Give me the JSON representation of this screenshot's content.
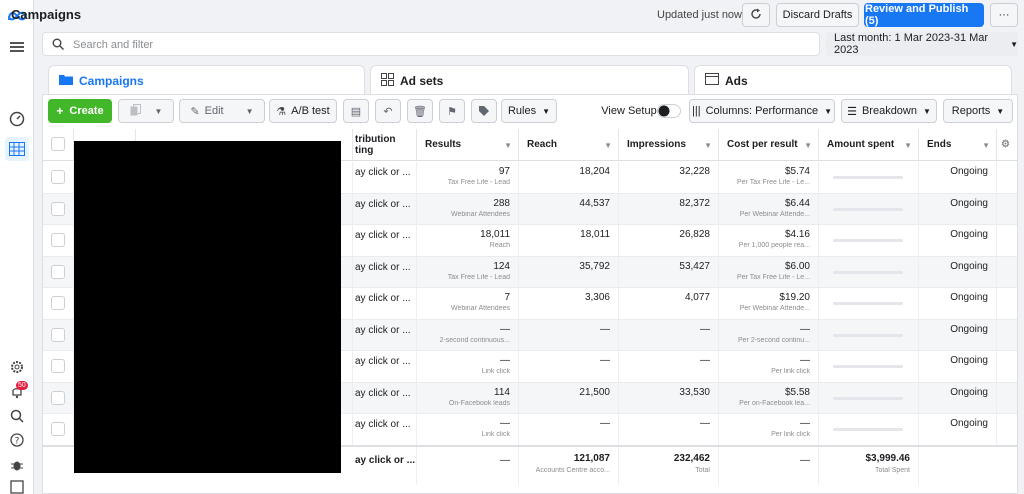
{
  "header": {
    "title": "Campaigns",
    "updated": "Updated just now",
    "discard": "Discard Drafts",
    "publish": "Review and Publish (5)",
    "more": "···"
  },
  "search": {
    "placeholder": "Search and filter"
  },
  "date_range": "Last month: 1 Mar 2023-31 Mar 2023",
  "tabs": [
    {
      "label": "Campaigns"
    },
    {
      "label": "Ad sets"
    },
    {
      "label": "Ads"
    }
  ],
  "toolbar": {
    "create": "Create",
    "edit": "Edit",
    "ab_test": "A/B test",
    "rules": "Rules",
    "view_setup": "View Setup",
    "columns": "Columns: Performance",
    "breakdown": "Breakdown",
    "reports": "Reports"
  },
  "columns": [
    "tribution\nting",
    "Results",
    "Reach",
    "Impressions",
    "Cost per result",
    "Amount spent",
    "Ends"
  ],
  "rows": [
    {
      "attr": "ay click or ...",
      "results": "97",
      "results_sub": "Tax Free Life - Lead",
      "reach": "18,204",
      "reach_sub": "",
      "impr": "32,228",
      "cpr": "$5.74",
      "cpr_sub": "Per Tax Free Life - Le...",
      "ends": "Ongoing"
    },
    {
      "attr": "ay click or ...",
      "results": "288",
      "results_sub": "Webinar Attendees",
      "reach": "44,537",
      "reach_sub": "",
      "impr": "82,372",
      "cpr": "$6.44",
      "cpr_sub": "Per Webinar Attende...",
      "ends": "Ongoing"
    },
    {
      "attr": "ay click or ...",
      "results": "18,011",
      "results_sub": "Reach",
      "reach": "18,011",
      "reach_sub": "",
      "impr": "26,828",
      "cpr": "$4.16",
      "cpr_sub": "Per 1,000 people rea...",
      "ends": "Ongoing"
    },
    {
      "attr": "ay click or ...",
      "results": "124",
      "results_sub": "Tax Free Life - Lead",
      "reach": "35,792",
      "reach_sub": "",
      "impr": "53,427",
      "cpr": "$6.00",
      "cpr_sub": "Per Tax Free Life - Le...",
      "ends": "Ongoing"
    },
    {
      "attr": "ay click or ...",
      "results": "7",
      "results_sub": "Webinar Attendees",
      "reach": "3,306",
      "reach_sub": "",
      "impr": "4,077",
      "cpr": "$19.20",
      "cpr_sub": "Per Webinar Attende...",
      "ends": "Ongoing"
    },
    {
      "attr": "ay click or ...",
      "results": "—",
      "results_sub": "2-second continuous...",
      "reach": "—",
      "reach_sub": "",
      "impr": "—",
      "cpr": "—",
      "cpr_sub": "Per 2-second continu...",
      "ends": "Ongoing"
    },
    {
      "attr": "ay click or ...",
      "results": "—",
      "results_sub": "Link click",
      "reach": "—",
      "reach_sub": "",
      "impr": "—",
      "cpr": "—",
      "cpr_sub": "Per link click",
      "ends": "Ongoing"
    },
    {
      "attr": "ay click or ...",
      "results": "114",
      "results_sub": "On-Facebook leads",
      "reach": "21,500",
      "reach_sub": "",
      "impr": "33,530",
      "cpr": "$5.58",
      "cpr_sub": "Per on-Facebook lea...",
      "ends": "Ongoing"
    },
    {
      "attr": "ay click or ...",
      "results": "—",
      "results_sub": "Link click",
      "reach": "—",
      "reach_sub": "",
      "impr": "—",
      "cpr": "—",
      "cpr_sub": "Per link click",
      "ends": "Ongoing"
    }
  ],
  "totals": {
    "attr": "ay click or ...",
    "results": "—",
    "reach": "121,087",
    "reach_sub": "Accounts Centre acco...",
    "impr": "232,462",
    "impr_sub": "Total",
    "cpr": "—",
    "amount": "$3,999.46",
    "amount_sub": "Total Spent"
  },
  "notifications_count": "50",
  "colors": {
    "primary": "#1877f2",
    "create": "#42b72a"
  }
}
